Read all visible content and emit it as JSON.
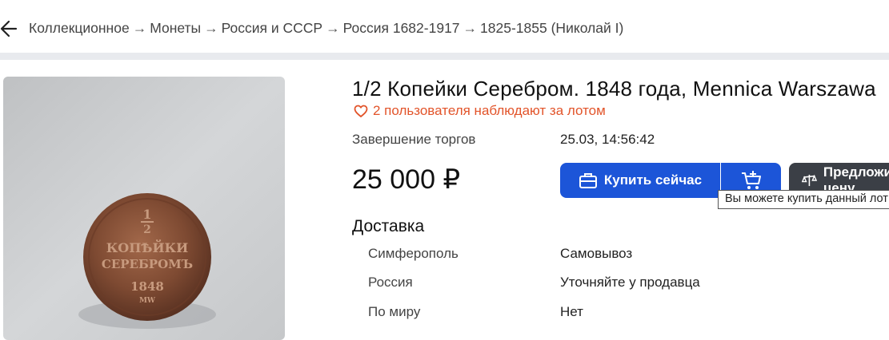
{
  "breadcrumb": {
    "items": [
      "Коллекционное",
      "Монеты",
      "Россия и СССР",
      "Россия 1682-1917",
      "1825-1855 (Николай I)"
    ],
    "separator": "→"
  },
  "lot": {
    "title": "1/2 Копейки Серебром. 1848 года, Mennica Warszawa",
    "watchers": "2 пользователя наблюдают за лотом",
    "end_label": "Завершение торгов",
    "end_value": "25.03, 14:56:42",
    "price": "25 000 ₽"
  },
  "actions": {
    "buy_label": "Купить сейчас",
    "offer_label": "Предложить цену",
    "tooltip": "Вы можете купить данный лот сразу"
  },
  "coin": {
    "line1": "1",
    "line2": "2",
    "line3": "КОПѢЙКИ",
    "line4": "СЕРЕБРОМЪ",
    "line5": "1848",
    "line6": "MW"
  },
  "delivery": {
    "heading": "Доставка",
    "rows": [
      {
        "place": "Симферополь",
        "value": "Самовывоз"
      },
      {
        "place": "Россия",
        "value": "Уточняйте у продавца"
      },
      {
        "place": "По миру",
        "value": "Нет"
      }
    ]
  },
  "colors": {
    "accent": "#1c55d8",
    "watch": "#e2542a",
    "dark_button": "#3b3f46",
    "strip": "#e8eaee"
  },
  "icons": [
    "arrow-left-icon",
    "heart-icon",
    "briefcase-icon",
    "cart-add-icon",
    "scales-icon"
  ]
}
